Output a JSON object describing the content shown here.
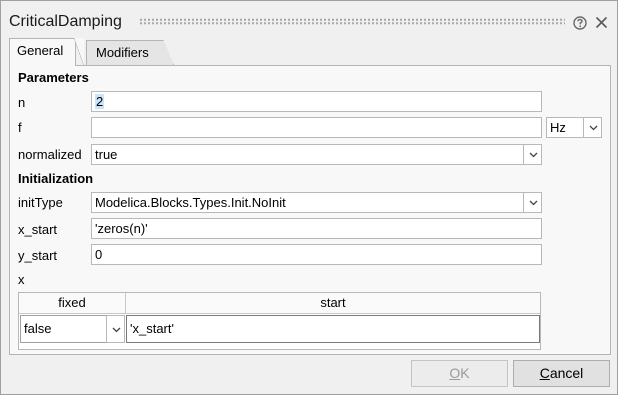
{
  "window": {
    "title": "CriticalDamping"
  },
  "tabs": [
    {
      "label": "General",
      "active": true
    },
    {
      "label": "Modifiers",
      "active": false
    }
  ],
  "parameters": {
    "heading": "Parameters",
    "n": {
      "label": "n",
      "value": "2"
    },
    "f": {
      "label": "f",
      "value": "",
      "unit": "Hz"
    },
    "normalized": {
      "label": "normalized",
      "value": "true"
    }
  },
  "initialization": {
    "heading": "Initialization",
    "initType": {
      "label": "initType",
      "value": "Modelica.Blocks.Types.Init.NoInit"
    },
    "x_start": {
      "label": "x_start",
      "value": "'zeros(n)'"
    },
    "y_start": {
      "label": "y_start",
      "value": "0"
    },
    "x": {
      "label": "x",
      "columns": [
        "fixed",
        "start"
      ],
      "rows": [
        {
          "fixed": "false",
          "start": "'x_start'"
        }
      ]
    }
  },
  "buttons": {
    "ok": {
      "mnemonic": "O",
      "rest": "K",
      "enabled": false
    },
    "cancel": {
      "mnemonic": "C",
      "rest": "ancel",
      "enabled": true
    }
  }
}
